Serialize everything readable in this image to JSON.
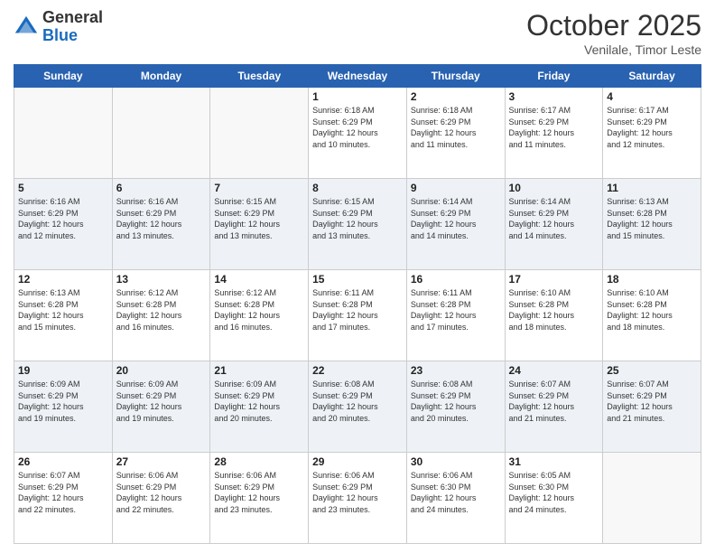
{
  "header": {
    "logo_general": "General",
    "logo_blue": "Blue",
    "month_title": "October 2025",
    "subtitle": "Venilale, Timor Leste"
  },
  "days_of_week": [
    "Sunday",
    "Monday",
    "Tuesday",
    "Wednesday",
    "Thursday",
    "Friday",
    "Saturday"
  ],
  "weeks": [
    [
      {
        "day": "",
        "info": ""
      },
      {
        "day": "",
        "info": ""
      },
      {
        "day": "",
        "info": ""
      },
      {
        "day": "1",
        "info": "Sunrise: 6:18 AM\nSunset: 6:29 PM\nDaylight: 12 hours\nand 10 minutes."
      },
      {
        "day": "2",
        "info": "Sunrise: 6:18 AM\nSunset: 6:29 PM\nDaylight: 12 hours\nand 11 minutes."
      },
      {
        "day": "3",
        "info": "Sunrise: 6:17 AM\nSunset: 6:29 PM\nDaylight: 12 hours\nand 11 minutes."
      },
      {
        "day": "4",
        "info": "Sunrise: 6:17 AM\nSunset: 6:29 PM\nDaylight: 12 hours\nand 12 minutes."
      }
    ],
    [
      {
        "day": "5",
        "info": "Sunrise: 6:16 AM\nSunset: 6:29 PM\nDaylight: 12 hours\nand 12 minutes."
      },
      {
        "day": "6",
        "info": "Sunrise: 6:16 AM\nSunset: 6:29 PM\nDaylight: 12 hours\nand 13 minutes."
      },
      {
        "day": "7",
        "info": "Sunrise: 6:15 AM\nSunset: 6:29 PM\nDaylight: 12 hours\nand 13 minutes."
      },
      {
        "day": "8",
        "info": "Sunrise: 6:15 AM\nSunset: 6:29 PM\nDaylight: 12 hours\nand 13 minutes."
      },
      {
        "day": "9",
        "info": "Sunrise: 6:14 AM\nSunset: 6:29 PM\nDaylight: 12 hours\nand 14 minutes."
      },
      {
        "day": "10",
        "info": "Sunrise: 6:14 AM\nSunset: 6:29 PM\nDaylight: 12 hours\nand 14 minutes."
      },
      {
        "day": "11",
        "info": "Sunrise: 6:13 AM\nSunset: 6:28 PM\nDaylight: 12 hours\nand 15 minutes."
      }
    ],
    [
      {
        "day": "12",
        "info": "Sunrise: 6:13 AM\nSunset: 6:28 PM\nDaylight: 12 hours\nand 15 minutes."
      },
      {
        "day": "13",
        "info": "Sunrise: 6:12 AM\nSunset: 6:28 PM\nDaylight: 12 hours\nand 16 minutes."
      },
      {
        "day": "14",
        "info": "Sunrise: 6:12 AM\nSunset: 6:28 PM\nDaylight: 12 hours\nand 16 minutes."
      },
      {
        "day": "15",
        "info": "Sunrise: 6:11 AM\nSunset: 6:28 PM\nDaylight: 12 hours\nand 17 minutes."
      },
      {
        "day": "16",
        "info": "Sunrise: 6:11 AM\nSunset: 6:28 PM\nDaylight: 12 hours\nand 17 minutes."
      },
      {
        "day": "17",
        "info": "Sunrise: 6:10 AM\nSunset: 6:28 PM\nDaylight: 12 hours\nand 18 minutes."
      },
      {
        "day": "18",
        "info": "Sunrise: 6:10 AM\nSunset: 6:28 PM\nDaylight: 12 hours\nand 18 minutes."
      }
    ],
    [
      {
        "day": "19",
        "info": "Sunrise: 6:09 AM\nSunset: 6:29 PM\nDaylight: 12 hours\nand 19 minutes."
      },
      {
        "day": "20",
        "info": "Sunrise: 6:09 AM\nSunset: 6:29 PM\nDaylight: 12 hours\nand 19 minutes."
      },
      {
        "day": "21",
        "info": "Sunrise: 6:09 AM\nSunset: 6:29 PM\nDaylight: 12 hours\nand 20 minutes."
      },
      {
        "day": "22",
        "info": "Sunrise: 6:08 AM\nSunset: 6:29 PM\nDaylight: 12 hours\nand 20 minutes."
      },
      {
        "day": "23",
        "info": "Sunrise: 6:08 AM\nSunset: 6:29 PM\nDaylight: 12 hours\nand 20 minutes."
      },
      {
        "day": "24",
        "info": "Sunrise: 6:07 AM\nSunset: 6:29 PM\nDaylight: 12 hours\nand 21 minutes."
      },
      {
        "day": "25",
        "info": "Sunrise: 6:07 AM\nSunset: 6:29 PM\nDaylight: 12 hours\nand 21 minutes."
      }
    ],
    [
      {
        "day": "26",
        "info": "Sunrise: 6:07 AM\nSunset: 6:29 PM\nDaylight: 12 hours\nand 22 minutes."
      },
      {
        "day": "27",
        "info": "Sunrise: 6:06 AM\nSunset: 6:29 PM\nDaylight: 12 hours\nand 22 minutes."
      },
      {
        "day": "28",
        "info": "Sunrise: 6:06 AM\nSunset: 6:29 PM\nDaylight: 12 hours\nand 23 minutes."
      },
      {
        "day": "29",
        "info": "Sunrise: 6:06 AM\nSunset: 6:29 PM\nDaylight: 12 hours\nand 23 minutes."
      },
      {
        "day": "30",
        "info": "Sunrise: 6:06 AM\nSunset: 6:30 PM\nDaylight: 12 hours\nand 24 minutes."
      },
      {
        "day": "31",
        "info": "Sunrise: 6:05 AM\nSunset: 6:30 PM\nDaylight: 12 hours\nand 24 minutes."
      },
      {
        "day": "",
        "info": ""
      }
    ]
  ]
}
